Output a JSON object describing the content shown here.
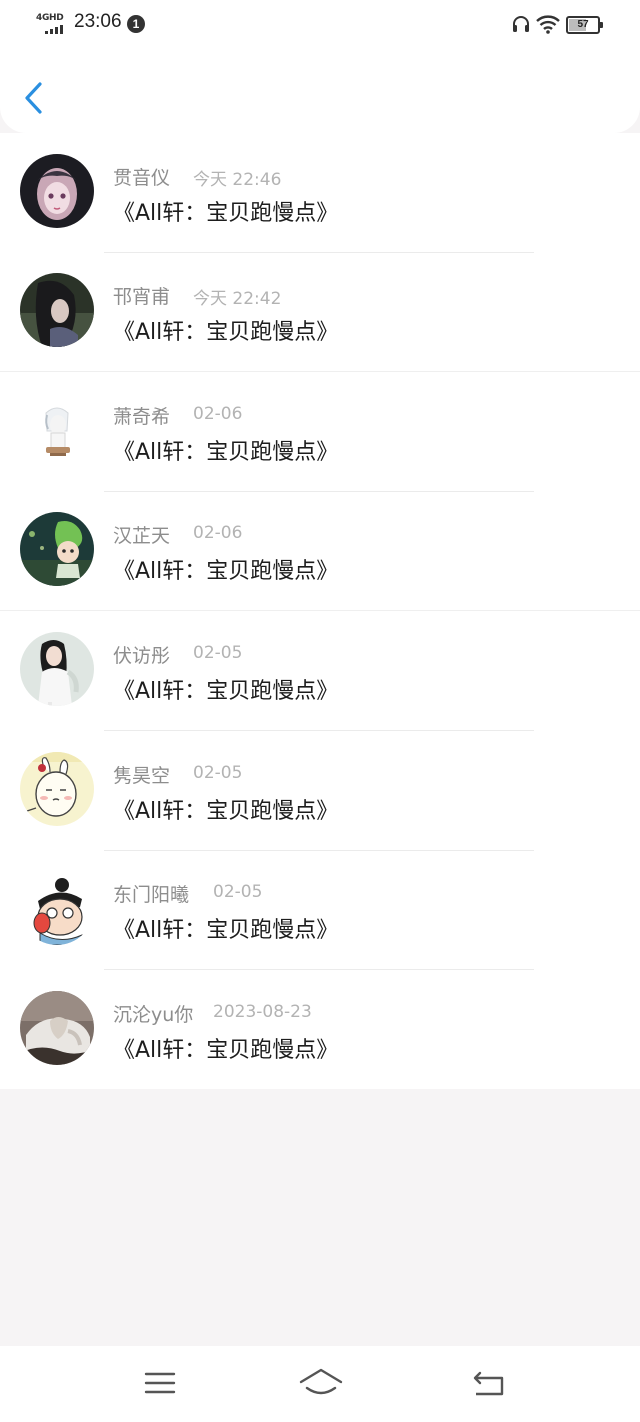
{
  "status_bar": {
    "network": "4GHD",
    "time": "23:06",
    "notification_count": "1",
    "battery_level": "57",
    "icons": [
      "signal-icon",
      "headphone-icon",
      "wifi-icon",
      "battery-icon"
    ]
  },
  "header": {
    "back_icon": "chevron-left-icon",
    "accent_color": "#2a8fe0"
  },
  "conversations": [
    {
      "name": "贯音仪",
      "time": "今天 22:46",
      "message": "《All轩：宝贝跑慢点》"
    },
    {
      "name": "邗宵甫",
      "time": "今天 22:42",
      "message": "《All轩：宝贝跑慢点》"
    },
    {
      "name": "萧奇希",
      "time": "02-06",
      "message": "《All轩：宝贝跑慢点》"
    },
    {
      "name": "汉芷天",
      "time": "02-06",
      "message": "《All轩：宝贝跑慢点》"
    },
    {
      "name": "伏访彤",
      "time": "02-05",
      "message": "《All轩：宝贝跑慢点》"
    },
    {
      "name": "隽昊空",
      "time": "02-05",
      "message": "《All轩：宝贝跑慢点》"
    },
    {
      "name": "东门阳曦",
      "time": "02-05",
      "message": "《All轩：宝贝跑慢点》"
    },
    {
      "name": "沉沦yu你",
      "time": "2023-08-23",
      "message": "《All轩：宝贝跑慢点》"
    }
  ],
  "nav_bar": {
    "icons": [
      "menu-icon",
      "home-icon",
      "back-icon"
    ]
  }
}
